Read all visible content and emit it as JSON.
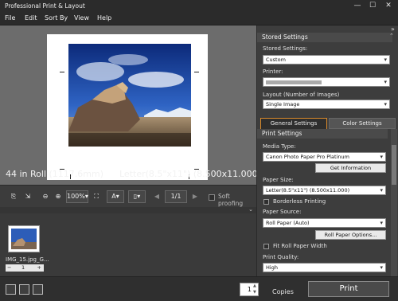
{
  "window": {
    "title": "Professional Print & Layout",
    "min": "—",
    "max": "☐",
    "close": "✕"
  },
  "menu": [
    "File",
    "Edit",
    "Sort By",
    "View",
    "Help"
  ],
  "preview": {
    "roll": "44 in Roll (1117.6mm)",
    "paper_size": "Letter(8.5\"x11\") (8.500x11.000)"
  },
  "toolbar": {
    "zoom": "100%",
    "page": "1/1",
    "soft_proofing": "Soft proofing",
    "text_tool": "A"
  },
  "thumbnails": [
    {
      "name": "IMG_15.jpg_G...",
      "copies": "1",
      "minus": "−",
      "plus": "+"
    }
  ],
  "panel": {
    "stored_header": "Stored Settings",
    "stored_label": "Stored Settings:",
    "stored_value": "Custom",
    "printer_label": "Printer:",
    "layout_label": "Layout (Number of Images)",
    "layout_value": "Single Image",
    "tabs": [
      "General Settings",
      "Color Settings"
    ],
    "print_header": "Print Settings",
    "media_label": "Media Type:",
    "media_value": "Canon Photo Paper Pro Platinum",
    "get_info": "Get Information",
    "paper_size_label": "Paper Size:",
    "paper_size_value": "Letter(8.5\"x11\") (8.500x11.000)",
    "borderless": "Borderless Printing",
    "source_label": "Paper Source:",
    "source_value": "Roll Paper (Auto)",
    "roll_options": "Roll Paper Options...",
    "fit_roll": "Fit Roll Paper Width",
    "quality_label": "Print Quality:",
    "quality_value": "High"
  },
  "bottom": {
    "copies_value": "1",
    "copies_label": "Copies",
    "print": "Print"
  }
}
